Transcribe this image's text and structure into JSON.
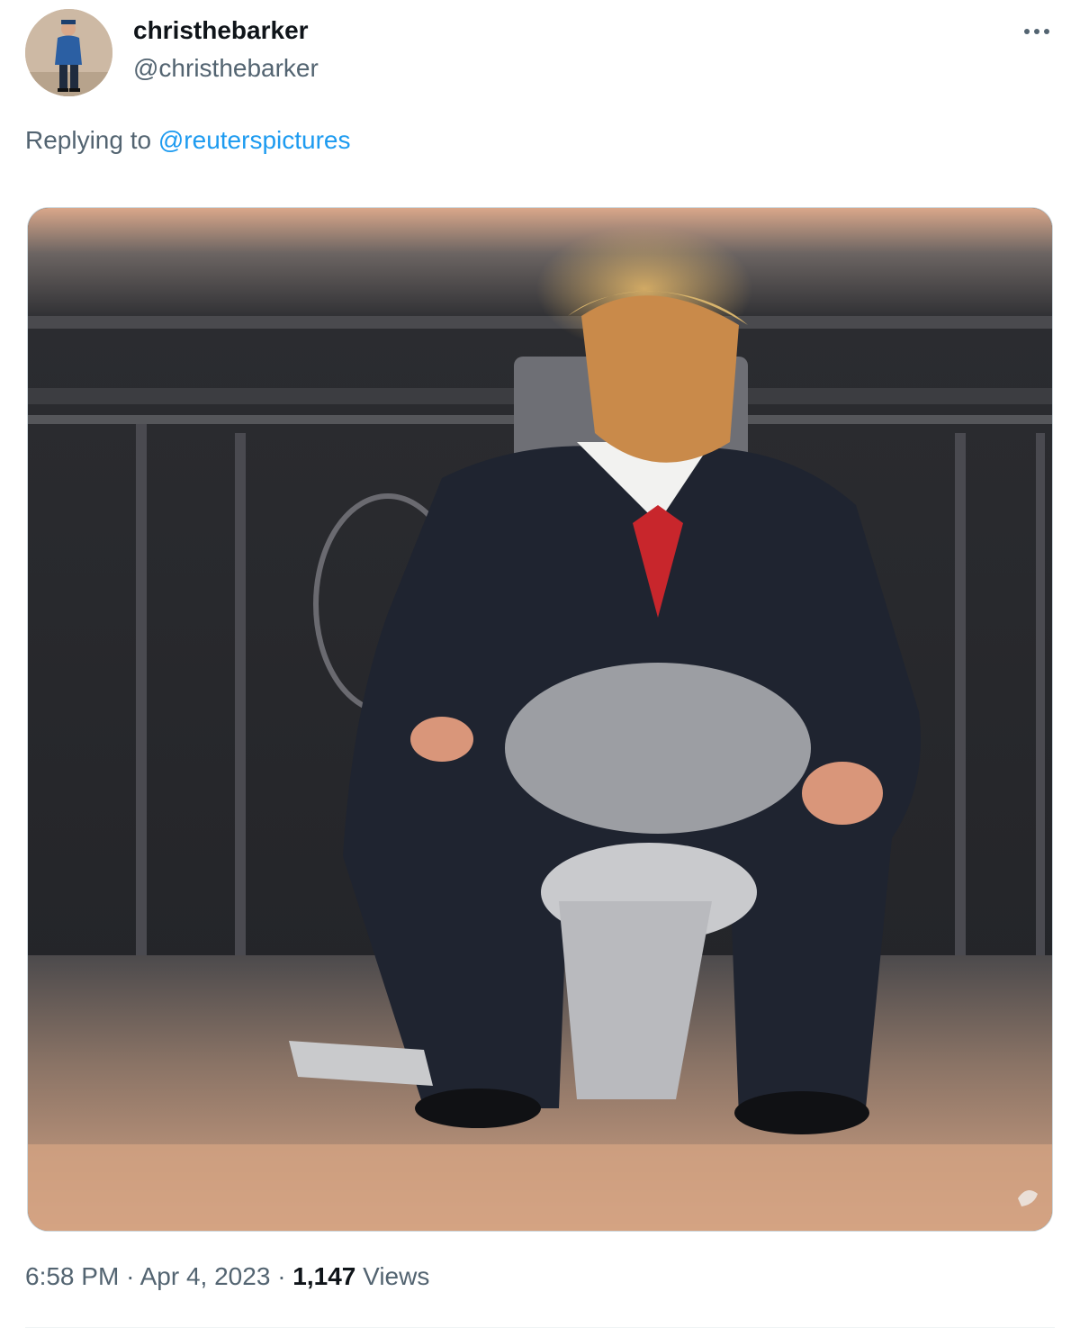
{
  "tweet": {
    "author": {
      "display_name": "christhebarker",
      "handle": "@christhebarker",
      "avatar_icon": "avatar-photo"
    },
    "more_icon": "more-icon",
    "replying_to": {
      "prefix": "Replying to",
      "mention": "@reuterspictures"
    },
    "media": {
      "icon": "courtroom-sketch-image"
    },
    "meta": {
      "time": "6:58 PM",
      "separator": "·",
      "date": "Apr 4, 2023",
      "views_count": "1,147",
      "views_label": "Views"
    }
  },
  "colors": {
    "link": "#1d9bf0",
    "secondary_text": "#536471",
    "primary_text": "#0f1419"
  }
}
